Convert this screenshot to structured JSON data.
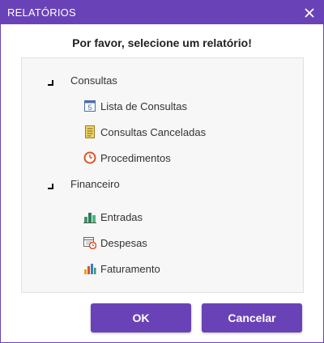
{
  "dialog": {
    "title": "RELATÓRIOS",
    "close_glyph": "✕",
    "heading": "Por favor, selecione um relatório!"
  },
  "tree": {
    "groups": [
      {
        "label": "Consultas",
        "items": [
          {
            "label": "Lista de Consultas",
            "icon": "calendar-5-icon"
          },
          {
            "label": "Consultas Canceladas",
            "icon": "document-list-icon"
          },
          {
            "label": "Procedimentos",
            "icon": "clock-icon"
          }
        ]
      },
      {
        "label": "Financeiro",
        "items": [
          {
            "label": "Entradas",
            "icon": "bar-chart-green-icon"
          },
          {
            "label": "Despesas",
            "icon": "calendar-clock-icon"
          },
          {
            "label": "Faturamento",
            "icon": "bar-chart-color-icon"
          }
        ]
      }
    ]
  },
  "buttons": {
    "ok_label": "OK",
    "cancel_label": "Cancelar"
  },
  "colors": {
    "accent": "#6a42b8",
    "tree_background": "#f7f7f7"
  }
}
